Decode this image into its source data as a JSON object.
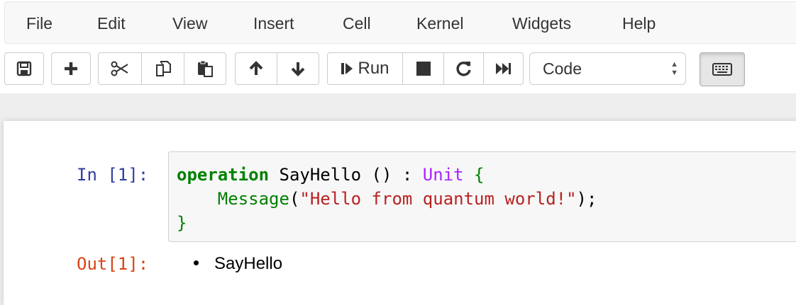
{
  "menu": {
    "items": [
      "File",
      "Edit",
      "View",
      "Insert",
      "Cell",
      "Kernel",
      "Widgets",
      "Help"
    ]
  },
  "toolbar": {
    "run_label": "Run",
    "cell_type": "Code",
    "buttons": [
      "save-icon",
      "plus-icon",
      "scissors-icon",
      "copy-icon",
      "paste-icon",
      "arrow-up-icon",
      "arrow-down-icon",
      "step-forward-icon",
      "stop-icon",
      "refresh-icon",
      "fast-forward-icon",
      "keyboard-icon"
    ]
  },
  "cell": {
    "in_prompt": "In [1]:",
    "out_prompt": "Out[1]:",
    "code": {
      "line1_kw": "operation",
      "line1_name": " SayHello () : ",
      "line1_type": "Unit",
      "line1_brace": " {",
      "line2_indent": "    ",
      "line2_fn": "Message",
      "line2_open": "(",
      "line2_str": "\"Hello from quantum world!\"",
      "line2_close": ");",
      "line3_brace": "}"
    },
    "output_items": [
      "SayHello"
    ]
  }
}
